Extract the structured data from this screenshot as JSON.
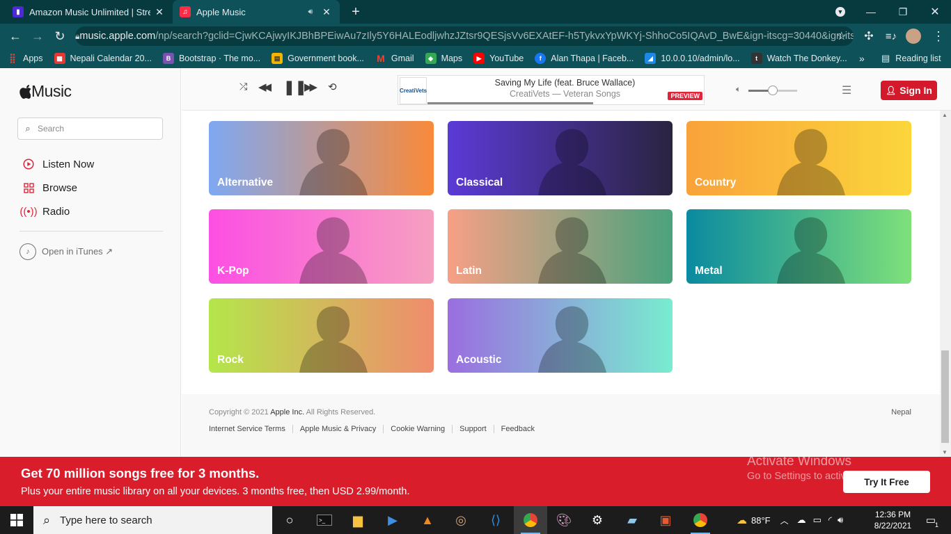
{
  "browser": {
    "tabs": [
      {
        "title": "Amazon Music Unlimited | Stream",
        "active": false,
        "favicon": "amazon-music-favicon",
        "color": "#4d2bd4"
      },
      {
        "title": "Apple Music",
        "active": true,
        "favicon": "apple-music-favicon",
        "color": "#fa2d48"
      }
    ],
    "url_host": "music.apple.com",
    "url_rest": "/np/search?gclid=CjwKCAjwyIKJBhBPEiwAu7zIly5Y6HALEodljwhzJZtsr9QESjsVv6EXAtEF-h5TykvxYpWKYj-ShhoCo5IQAvD_BwE&ign-itscg=30440&ign-its...",
    "bookmarks": [
      {
        "label": "Apps",
        "icon": "apps-grid-icon",
        "color": "#ea4335"
      },
      {
        "label": "Nepali Calendar 20...",
        "icon": "calendar-icon",
        "color": "#e53935"
      },
      {
        "label": "Bootstrap · The mo...",
        "icon": "bootstrap-icon",
        "color": "#7952b3"
      },
      {
        "label": "Government book...",
        "icon": "book-icon",
        "color": "#f4b400"
      },
      {
        "label": "Gmail",
        "icon": "gmail-icon",
        "color": "#ea4335"
      },
      {
        "label": "Maps",
        "icon": "maps-icon",
        "color": "#34a853"
      },
      {
        "label": "YouTube",
        "icon": "youtube-icon",
        "color": "#ff0000"
      },
      {
        "label": "Alan Thapa | Faceb...",
        "icon": "facebook-icon",
        "color": "#1877f2"
      },
      {
        "label": "10.0.0.10/admin/lo...",
        "icon": "router-icon",
        "color": "#1e88e5"
      },
      {
        "label": "Watch The Donkey...",
        "icon": "video-icon",
        "color": "#333333"
      }
    ],
    "reading_list": "Reading list"
  },
  "sidebar": {
    "logo_text": "Music",
    "search_placeholder": "Search",
    "nav": [
      {
        "label": "Listen Now",
        "icon": "play-circle-icon"
      },
      {
        "label": "Browse",
        "icon": "grid-icon"
      },
      {
        "label": "Radio",
        "icon": "radio-icon"
      }
    ],
    "open_itunes": "Open in iTunes ↗"
  },
  "player": {
    "song_title": "Saving My Life (feat. Bruce Wallace)",
    "song_subtitle": "CreatiVets —  Veteran Songs",
    "badge": "PREVIEW",
    "album_art_text": "CreatiVets",
    "progress": 0.54,
    "volume": 0.5,
    "sign_in": "Sign In"
  },
  "genres": [
    {
      "label": "Alternative",
      "from": "#7fa8f2",
      "to": "#f98a3a"
    },
    {
      "label": "Classical",
      "from": "#5b3ad6",
      "to": "#2a2440"
    },
    {
      "label": "Country",
      "from": "#f9a23b",
      "to": "#fbd63b"
    },
    {
      "label": "K-Pop",
      "from": "#fc4fe3",
      "to": "#f6a0c0"
    },
    {
      "label": "Latin",
      "from": "#f7a085",
      "to": "#4aa37d"
    },
    {
      "label": "Metal",
      "from": "#0a8aa0",
      "to": "#7fe07a"
    },
    {
      "label": "Rock",
      "from": "#b4e64a",
      "to": "#f08c6d"
    },
    {
      "label": "Acoustic",
      "from": "#9b6ee0",
      "to": "#78ecd0"
    }
  ],
  "footer": {
    "copyright_prefix": "Copyright © 2021 ",
    "company": "Apple Inc.",
    "rights": " All Rights Reserved.",
    "country": "Nepal",
    "links": [
      "Internet Service Terms",
      "Apple Music & Privacy",
      "Cookie Warning",
      "Support",
      "Feedback"
    ]
  },
  "banner": {
    "headline": "Get 70 million songs free for 3 months.",
    "subline": "Plus your entire music library on all your devices. 3 months free, then USD 2.99/month.",
    "cta": "Try It Free",
    "watermark_title": "Activate Windows",
    "watermark_sub": "Go to Settings to activate Windows."
  },
  "taskbar": {
    "search_placeholder": "Type here to search",
    "temperature": "88°F",
    "time": "12:36 PM",
    "date": "8/22/2021",
    "notifications": "1"
  }
}
